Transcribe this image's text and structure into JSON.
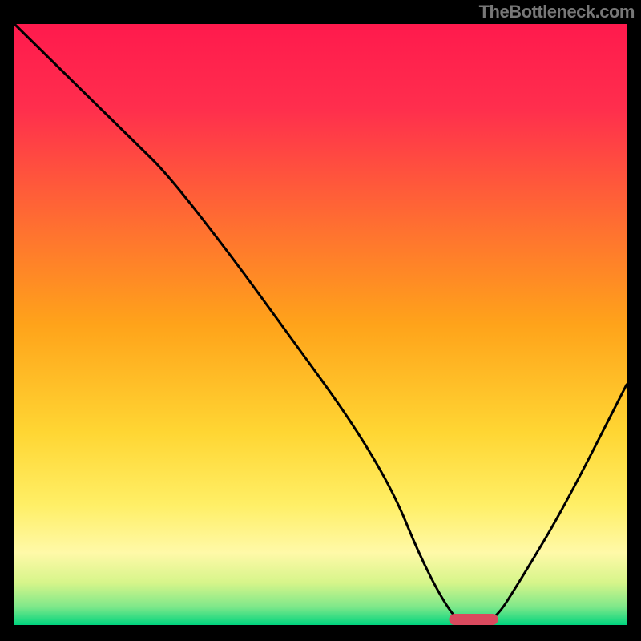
{
  "watermark": "TheBottleneck.com",
  "chart_data": {
    "type": "line",
    "title": "",
    "xlabel": "",
    "ylabel": "",
    "xlim": [
      0,
      100
    ],
    "ylim": [
      0,
      100
    ],
    "x": [
      0,
      10,
      20,
      25,
      35,
      45,
      55,
      62,
      66,
      70,
      73,
      78,
      83,
      90,
      100
    ],
    "values": [
      100,
      90,
      80,
      75,
      62,
      48,
      34,
      22,
      12,
      4,
      0,
      0,
      8,
      20,
      40
    ],
    "optimal_range": [
      71,
      79
    ],
    "gradient": {
      "top": "#ff1a4d",
      "mid": "#ffd633",
      "bottom": "#00d47e"
    },
    "marker_color": "#d94a5e"
  }
}
